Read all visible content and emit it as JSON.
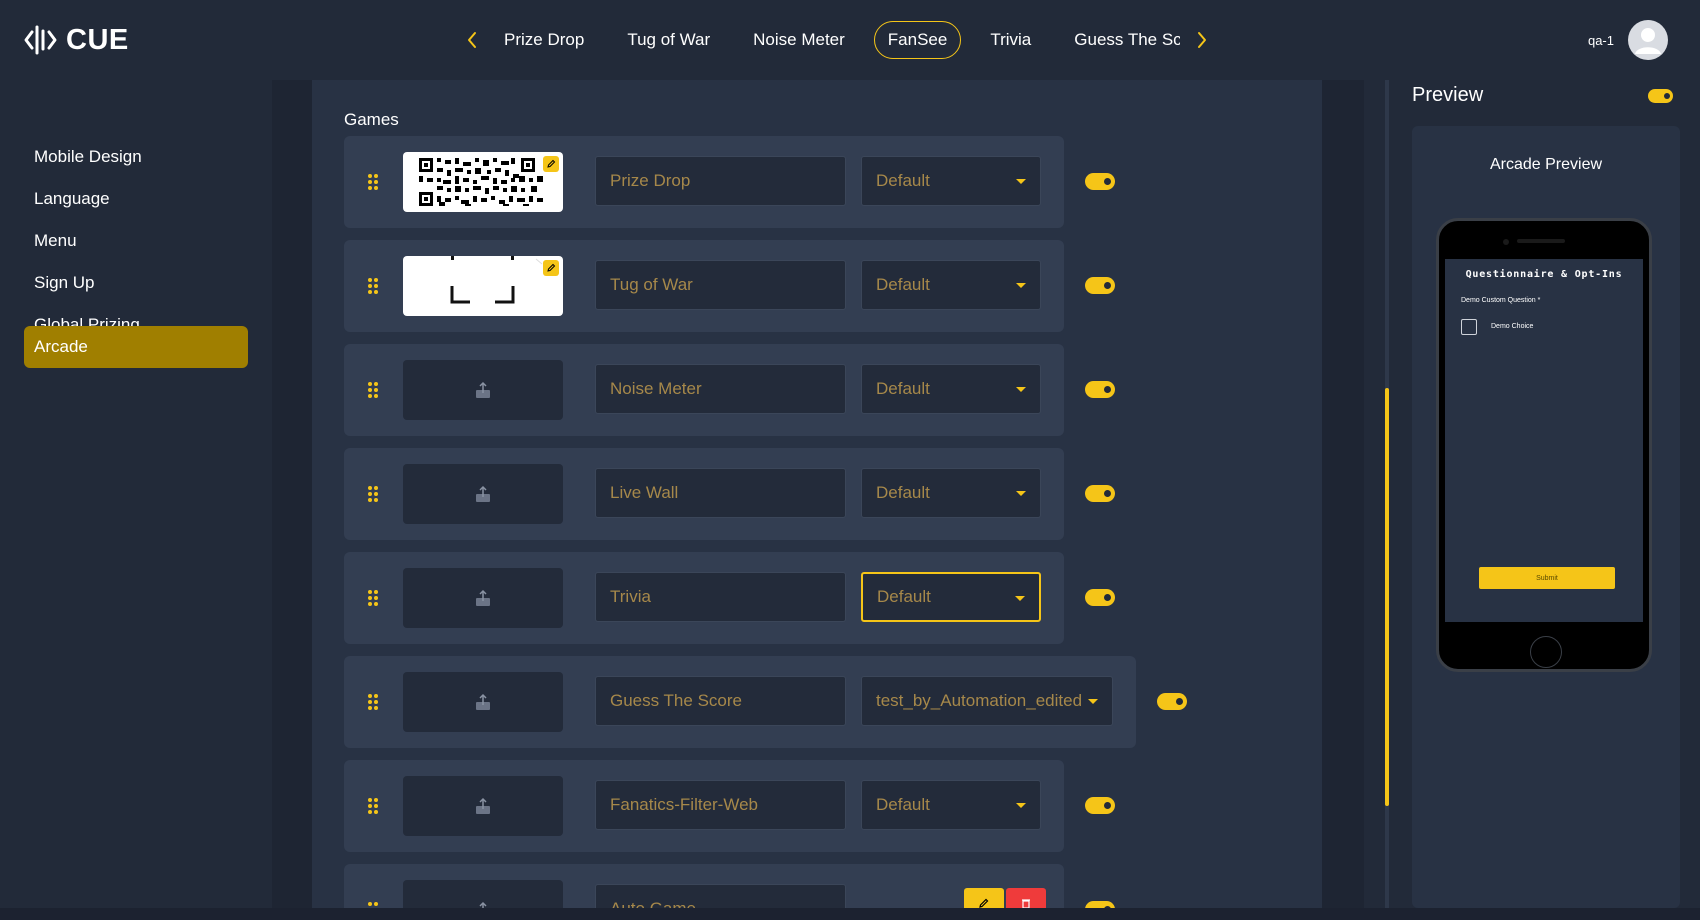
{
  "app": {
    "logo_text": "CUE",
    "user_name": "qa-1"
  },
  "colors": {
    "accent": "#f5c518",
    "active_sidebar": "#a07f00",
    "background": "#222a39",
    "delete": "#ef3b3b"
  },
  "tabs": [
    {
      "label": "Prize Drop",
      "active": false
    },
    {
      "label": "Tug of War",
      "active": false
    },
    {
      "label": "Noise Meter",
      "active": false
    },
    {
      "label": "FanSee",
      "active": true
    },
    {
      "label": "Trivia",
      "active": false
    },
    {
      "label": "Guess The Score",
      "active": false
    }
  ],
  "sidebar": {
    "items": [
      {
        "label": "Mobile Design",
        "active": false
      },
      {
        "label": "Language",
        "active": false
      },
      {
        "label": "Menu",
        "active": false
      },
      {
        "label": "Sign Up",
        "active": false
      },
      {
        "label": "Global Prizing",
        "active": false
      },
      {
        "label": "Arcade",
        "active": true
      }
    ]
  },
  "games": {
    "title": "Games",
    "rows": [
      {
        "name": "Prize Drop",
        "theme": "Default",
        "enabled": true,
        "thumbnail": "qr-code-image"
      },
      {
        "name": "Tug of War",
        "theme": "Default",
        "enabled": true,
        "thumbnail": "corner-frame-image"
      },
      {
        "name": "Noise Meter",
        "theme": "Default",
        "enabled": true,
        "thumbnail": "upload-icon"
      },
      {
        "name": "Live Wall",
        "theme": "Default",
        "enabled": true,
        "thumbnail": "upload-icon"
      },
      {
        "name": "Trivia",
        "theme": "Default",
        "enabled": true,
        "thumbnail": "upload-icon",
        "focused": true
      },
      {
        "name": "Guess The Score",
        "theme": "test_by_Automation_edited",
        "enabled": true,
        "thumbnail": "upload-icon"
      },
      {
        "name": "Fanatics-Filter-Web",
        "theme": "Default",
        "enabled": true,
        "thumbnail": "upload-icon"
      },
      {
        "name": "Auto Game",
        "theme": "",
        "enabled": true,
        "thumbnail": "upload-icon",
        "actions": [
          "edit-icon",
          "trash-icon"
        ]
      }
    ]
  },
  "preview": {
    "title": "Preview",
    "enabled": true,
    "heading": "Arcade Preview",
    "screen": {
      "title": "Questionnaire & Opt-Ins",
      "question_label": "Demo Custom Question *",
      "choice_label": "Demo Choice",
      "submit_label": "Submit"
    }
  }
}
